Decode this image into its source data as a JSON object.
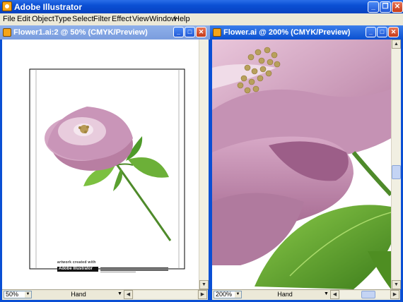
{
  "app": {
    "title": "Adobe Illustrator"
  },
  "menu": [
    "File",
    "Edit",
    "Object",
    "Type",
    "Select",
    "Filter",
    "Effect",
    "View",
    "Window",
    "Help"
  ],
  "left_window": {
    "title": "Flower1.ai:2 @ 50% (CMYK/Preview)",
    "zoom": "50%",
    "tool": "Hand",
    "credit_line1": "artwork created with",
    "credit_logo": "Adobe Illustrator"
  },
  "right_window": {
    "title": "Flower.ai @ 200% (CMYK/Preview)",
    "zoom": "200%",
    "tool": "Hand"
  },
  "colors": {
    "titlebar": "#0A4FD4",
    "chrome": "#ECE9D8",
    "petal": "#C28AAE",
    "leaf": "#5E9E2C"
  }
}
